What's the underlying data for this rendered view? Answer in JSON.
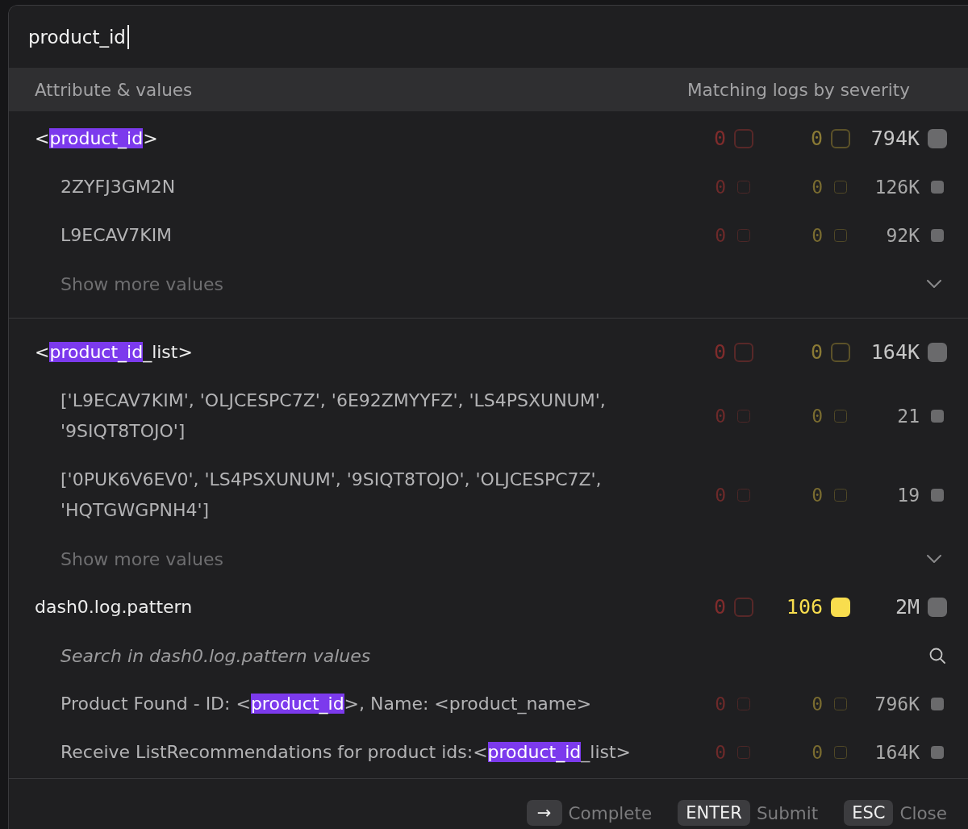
{
  "search": {
    "value": "product_id"
  },
  "header": {
    "left": "Attribute & values",
    "right": "Matching logs by severity"
  },
  "groups": [
    {
      "rows": [
        {
          "kind": "attribute",
          "segments": [
            {
              "text": "<",
              "highlighted": false
            },
            {
              "text": "product_id",
              "highlighted": true
            },
            {
              "text": ">",
              "highlighted": false
            }
          ],
          "counts": [
            {
              "kind": "error",
              "count": "0",
              "active": false
            },
            {
              "kind": "warning",
              "count": "0",
              "active": false
            },
            {
              "kind": "info",
              "count": "794K",
              "active": true
            }
          ]
        },
        {
          "kind": "value",
          "segments": [
            {
              "text": "2ZYFJ3GM2N",
              "highlighted": false
            }
          ],
          "counts": [
            {
              "kind": "error",
              "count": "0",
              "active": false
            },
            {
              "kind": "warning",
              "count": "0",
              "active": false
            },
            {
              "kind": "info",
              "count": "126K",
              "active": true
            }
          ]
        },
        {
          "kind": "value",
          "segments": [
            {
              "text": "L9ECAV7KIM",
              "highlighted": false
            }
          ],
          "counts": [
            {
              "kind": "error",
              "count": "0",
              "active": false
            },
            {
              "kind": "warning",
              "count": "0",
              "active": false
            },
            {
              "kind": "info",
              "count": "92K",
              "active": true
            }
          ]
        },
        {
          "kind": "more",
          "label": "Show more values"
        },
        {
          "kind": "divider"
        }
      ]
    },
    {
      "rows": [
        {
          "kind": "attribute",
          "segments": [
            {
              "text": "<",
              "highlighted": false
            },
            {
              "text": "product_id",
              "highlighted": true
            },
            {
              "text": "_list>",
              "highlighted": false
            }
          ],
          "counts": [
            {
              "kind": "error",
              "count": "0",
              "active": false
            },
            {
              "kind": "warning",
              "count": "0",
              "active": false
            },
            {
              "kind": "info",
              "count": "164K",
              "active": true
            }
          ]
        },
        {
          "kind": "value",
          "segments": [
            {
              "text": "['L9ECAV7KIM', 'OLJCESPC7Z', '6E92ZMYYFZ', 'LS4PSXUNUM', '9SIQT8TOJO']",
              "highlighted": false
            }
          ],
          "counts": [
            {
              "kind": "error",
              "count": "0",
              "active": false
            },
            {
              "kind": "warning",
              "count": "0",
              "active": false
            },
            {
              "kind": "info",
              "count": "21",
              "active": true
            }
          ]
        },
        {
          "kind": "value",
          "segments": [
            {
              "text": "['0PUK6V6EV0', 'LS4PSXUNUM', '9SIQT8TOJO', 'OLJCESPC7Z', 'HQTGWGPNH4']",
              "highlighted": false
            }
          ],
          "counts": [
            {
              "kind": "error",
              "count": "0",
              "active": false
            },
            {
              "kind": "warning",
              "count": "0",
              "active": false
            },
            {
              "kind": "info",
              "count": "19",
              "active": true
            }
          ]
        },
        {
          "kind": "more",
          "label": "Show more values"
        }
      ]
    },
    {
      "rows": [
        {
          "kind": "attribute",
          "segments": [
            {
              "text": "dash0.log.pattern",
              "highlighted": false
            }
          ],
          "counts": [
            {
              "kind": "error",
              "count": "0",
              "active": false
            },
            {
              "kind": "warning",
              "count": "106",
              "active": true
            },
            {
              "kind": "info",
              "count": "2M",
              "active": true
            }
          ]
        },
        {
          "kind": "search",
          "placeholder": "Search in dash0.log.pattern values"
        },
        {
          "kind": "value",
          "segments": [
            {
              "text": "Product Found - ID: <",
              "highlighted": false
            },
            {
              "text": "product_id",
              "highlighted": true
            },
            {
              "text": ">, Name: <product_name>",
              "highlighted": false
            }
          ],
          "counts": [
            {
              "kind": "error",
              "count": "0",
              "active": false
            },
            {
              "kind": "warning",
              "count": "0",
              "active": false
            },
            {
              "kind": "info",
              "count": "796K",
              "active": true
            }
          ]
        },
        {
          "kind": "value",
          "segments": [
            {
              "text": "Receive ListRecommendations for product ids:<",
              "highlighted": false
            },
            {
              "text": "product_id",
              "highlighted": true
            },
            {
              "text": "_list>",
              "highlighted": false
            }
          ],
          "counts": [
            {
              "kind": "error",
              "count": "0",
              "active": false
            },
            {
              "kind": "warning",
              "count": "0",
              "active": false
            },
            {
              "kind": "info",
              "count": "164K",
              "active": true
            }
          ]
        }
      ]
    }
  ],
  "shortcuts": [
    {
      "key": "→",
      "label": "Complete"
    },
    {
      "key": "ENTER",
      "label": "Submit"
    },
    {
      "key": "ESC",
      "label": "Close"
    }
  ]
}
